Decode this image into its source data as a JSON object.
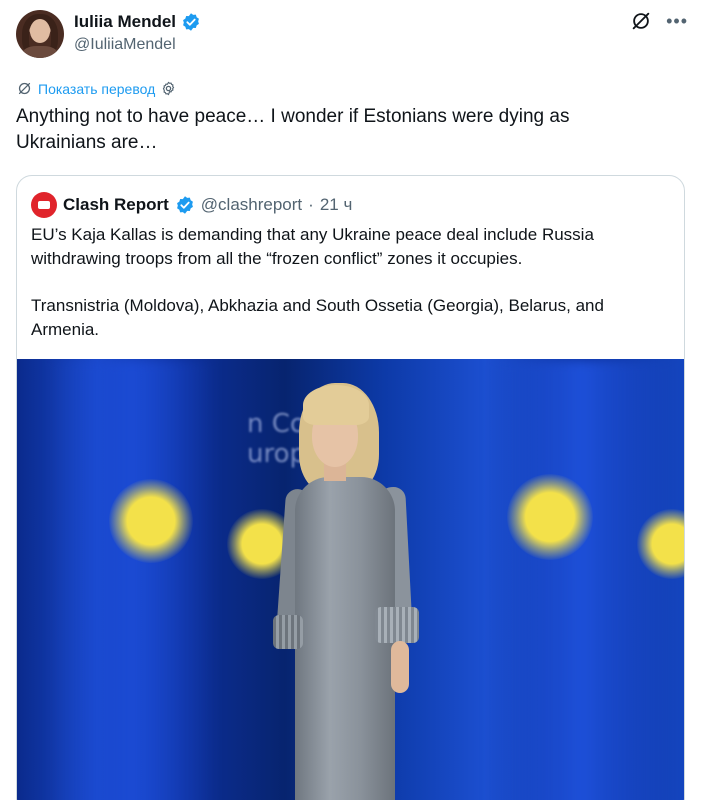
{
  "tweet": {
    "author_name": "Iuliia Mendel",
    "author_handle": "@IuliiaMendel",
    "translate_label": "Показать перевод",
    "text": "Anything not to have peace… I wonder if Estonians were dying as Ukrainians are…"
  },
  "quote": {
    "author_name": "Clash Report",
    "author_handle": "@clashreport",
    "separator": "·",
    "time": "21 ч",
    "paragraph_1": "EU’s Kaja Kallas is demanding that any Ukraine peace deal include Russia withdrawing troops from all the “frozen conflict” zones it occupies.",
    "paragraph_2": "Transnistria (Moldova), Abkhazia and South Ossetia (Georgia), Belarus, and Armenia.",
    "image_wall_text_1": "n Cou",
    "image_wall_text_2": "urop"
  },
  "icons": {
    "verified": "verified-badge-icon",
    "grok": "grok-icon",
    "more": "more-options-icon",
    "translate": "translate-icon",
    "settings": "gear-icon"
  },
  "colors": {
    "accent": "#1d9bf0",
    "text": "#0f1419",
    "muted": "#536471",
    "border": "#cfd9de",
    "clash_logo": "#e0242b"
  }
}
